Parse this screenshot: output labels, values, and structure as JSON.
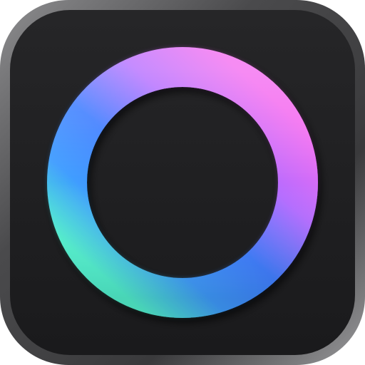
{
  "app_icon": {
    "name": "ring-app-icon",
    "colors": {
      "page_background": "#ffffff",
      "frame_outer": "#8a8a8a",
      "frame_inner": "#3a3a3c",
      "tile_background": "#1e1e20",
      "ring_magenta": "#f06af2",
      "ring_violet": "#b56cff",
      "ring_blue": "#3d7bff",
      "ring_cyan": "#4ef0d2"
    }
  }
}
